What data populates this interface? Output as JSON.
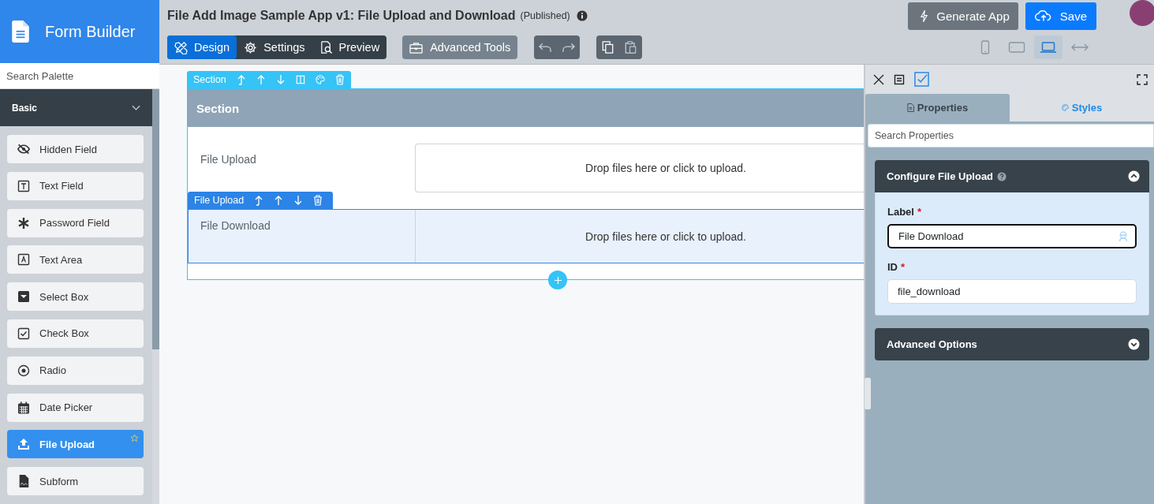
{
  "sidebar": {
    "title": "Form Builder",
    "search": {
      "placeholder": "Search Palette"
    },
    "group": {
      "label": "Basic",
      "expanded": true
    },
    "items": [
      {
        "label": "Hidden Field",
        "kind": "eye-off",
        "selected": false,
        "starred": false
      },
      {
        "label": "Text Field",
        "kind": "text-box",
        "selected": false,
        "starred": false
      },
      {
        "label": "Password Field",
        "kind": "asterisk",
        "selected": false,
        "starred": false
      },
      {
        "label": "Text Area",
        "kind": "textarea",
        "selected": false,
        "starred": false
      },
      {
        "label": "Select Box",
        "kind": "select",
        "selected": false,
        "starred": false
      },
      {
        "label": "Check Box",
        "kind": "checkbox",
        "selected": false,
        "starred": false
      },
      {
        "label": "Radio",
        "kind": "radio",
        "selected": false,
        "starred": false
      },
      {
        "label": "Date Picker",
        "kind": "calendar",
        "selected": false,
        "starred": false
      },
      {
        "label": "File Upload",
        "kind": "upload",
        "selected": true,
        "starred": true
      },
      {
        "label": "Subform",
        "kind": "document",
        "selected": false,
        "starred": false
      }
    ]
  },
  "header": {
    "title": "File Add Image Sample App v1: File Upload and Download",
    "status": "(Published)",
    "tabs": [
      {
        "label": "Design",
        "kind": "design",
        "selected": true
      },
      {
        "label": "Settings",
        "kind": "gear",
        "selected": false
      },
      {
        "label": "Preview",
        "kind": "preview",
        "selected": false
      }
    ],
    "tools_button": "Advanced Tools",
    "generate_button": "Generate App",
    "save_button": "Save",
    "devices": [
      {
        "kind": "phone",
        "selected": false
      },
      {
        "kind": "tablet",
        "selected": false
      },
      {
        "kind": "laptop",
        "selected": true
      },
      {
        "kind": "full-width",
        "selected": false
      }
    ]
  },
  "canvas": {
    "section_toolbar": "Section",
    "section_title": "Section",
    "fields": [
      {
        "label": "File Upload",
        "dropzone": "Drop files here or click to upload.",
        "selected": false
      },
      {
        "label": "File Download",
        "dropzone": "Drop files here or click to upload.",
        "selected": true,
        "toolbar": "File Upload"
      }
    ]
  },
  "properties": {
    "tabs": [
      {
        "label": "Properties",
        "kind": "doc",
        "selected": true
      },
      {
        "label": "Styles",
        "kind": "palette",
        "selected": false
      }
    ],
    "search": {
      "placeholder": "Search Properties"
    },
    "panels": [
      {
        "title": "Configure File Upload",
        "expanded": true,
        "fields": [
          {
            "label": "Label",
            "required": "*",
            "value": "File Download",
            "focused": true
          },
          {
            "label": "ID",
            "required": "*",
            "value": "file_download",
            "focused": false
          }
        ]
      },
      {
        "title": "Advanced Options",
        "expanded": false
      }
    ]
  }
}
